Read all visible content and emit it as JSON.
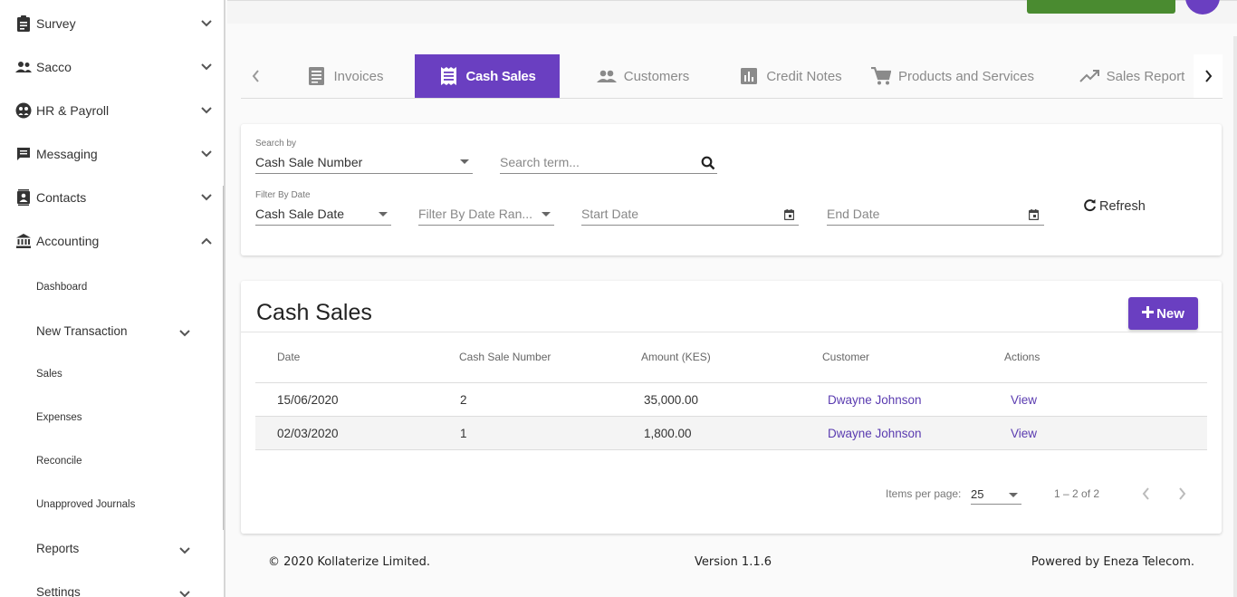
{
  "sidebar": {
    "items": [
      {
        "label": "Survey",
        "icon": "clipboard-icon"
      },
      {
        "label": "Sacco",
        "icon": "group-icon"
      },
      {
        "label": "HR & Payroll",
        "icon": "hr-icon"
      },
      {
        "label": "Messaging",
        "icon": "chat-icon"
      },
      {
        "label": "Contacts",
        "icon": "contacts-icon"
      },
      {
        "label": "Accounting",
        "icon": "bank-icon"
      }
    ],
    "sub_items": [
      {
        "label": "Dashboard"
      },
      {
        "label": "New Transaction"
      },
      {
        "label": "Sales"
      },
      {
        "label": "Expenses"
      },
      {
        "label": "Reconcile"
      },
      {
        "label": "Unapproved Journals"
      },
      {
        "label": "Reports"
      },
      {
        "label": "Settings"
      }
    ]
  },
  "tabs": [
    {
      "label": "Invoices",
      "icon": "document-icon"
    },
    {
      "label": "Cash Sales",
      "icon": "receipt-icon",
      "active": true
    },
    {
      "label": "Customers",
      "icon": "people-icon"
    },
    {
      "label": "Credit Notes",
      "icon": "bar-chart-icon"
    },
    {
      "label": "Products and Services",
      "icon": "cart-icon"
    },
    {
      "label": "Sales Report",
      "icon": "trending-icon"
    }
  ],
  "filters": {
    "search_by_label": "Search by",
    "search_by_value": "Cash Sale Number",
    "search_placeholder": "Search term...",
    "filter_date_label": "Filter By Date",
    "filter_date_value": "Cash Sale Date",
    "date_range_placeholder": "Filter By Date Ran...",
    "start_date_placeholder": "Start Date",
    "end_date_placeholder": "End Date",
    "refresh_label": "Refresh"
  },
  "cash_sales": {
    "title": "Cash Sales",
    "new_button": "New",
    "columns": [
      "Date",
      "Cash Sale Number",
      "Amount (KES)",
      "Customer",
      "Actions"
    ],
    "rows": [
      {
        "date": "15/06/2020",
        "number": "2",
        "amount": "35,000.00",
        "customer": "Dwayne Johnson",
        "action": "View"
      },
      {
        "date": "02/03/2020",
        "number": "1",
        "amount": "1,800.00",
        "customer": "Dwayne Johnson",
        "action": "View"
      }
    ],
    "pager": {
      "items_per_page_label": "Items per page:",
      "items_per_page_value": "25",
      "range": "1 – 2 of 2"
    }
  },
  "footer": {
    "copyright": "© 2020 Kollaterize Limited.",
    "version": "Version 1.1.6",
    "powered_by": "Powered by Eneza Telecom."
  },
  "colors": {
    "accent": "#6a3fc1",
    "link": "#5a3bb0",
    "top_button": "#4a8b30"
  }
}
